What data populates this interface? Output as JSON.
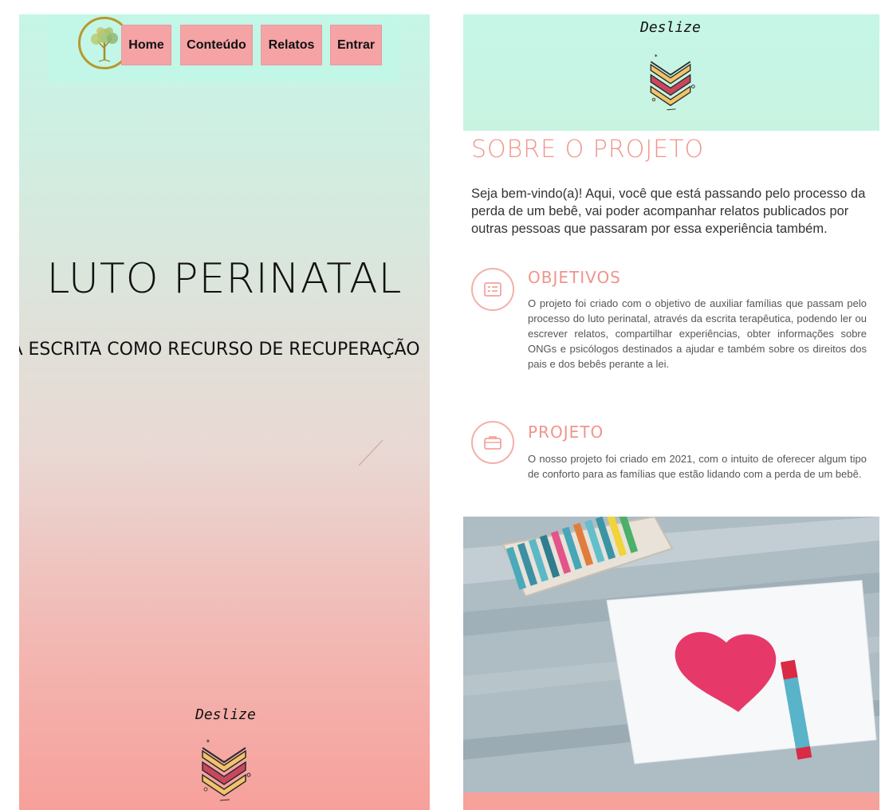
{
  "nav": {
    "items": [
      {
        "label": "Home"
      },
      {
        "label": "Conteúdo"
      },
      {
        "label": "Relatos"
      },
      {
        "label": "Entrar"
      }
    ]
  },
  "hero": {
    "title": "LUTO PERINATAL",
    "subtitle": "A ESCRITA COMO RECURSO DE RECUPERAÇÃO"
  },
  "scroll": {
    "label": "Deslize"
  },
  "about": {
    "title": "SOBRE O PROJETO",
    "intro": "Seja bem-vindo(a)! Aqui, você que está passando pelo processo da perda de um bebê, vai poder acompanhar relatos publicados por outras pessoas que passaram por essa experiência também.",
    "features": [
      {
        "icon": "list-icon",
        "title": "OBJETIVOS",
        "text": "O projeto foi criado com o objetivo de auxiliar famílias que passam pelo processo do luto perinatal, através da escrita terapêutica, podendo ler ou escrever relatos, compartilhar experiências, obter informações sobre ONGs e psicólogos destinados a ajudar e também sobre os direitos dos pais e dos bebês perante a lei."
      },
      {
        "icon": "briefcase-icon",
        "title": "PROJETO",
        "text": "O nosso projeto foi criado em 2021, com o intuito de oferecer algum tipo de conforto para as famílias que estão lidando com a perda de um bebê."
      }
    ]
  },
  "colors": {
    "mint": "#c5f6e7",
    "pink_button": "#f5a3a5",
    "accent_coral": "#f1948b",
    "gold": "#b7992d"
  }
}
